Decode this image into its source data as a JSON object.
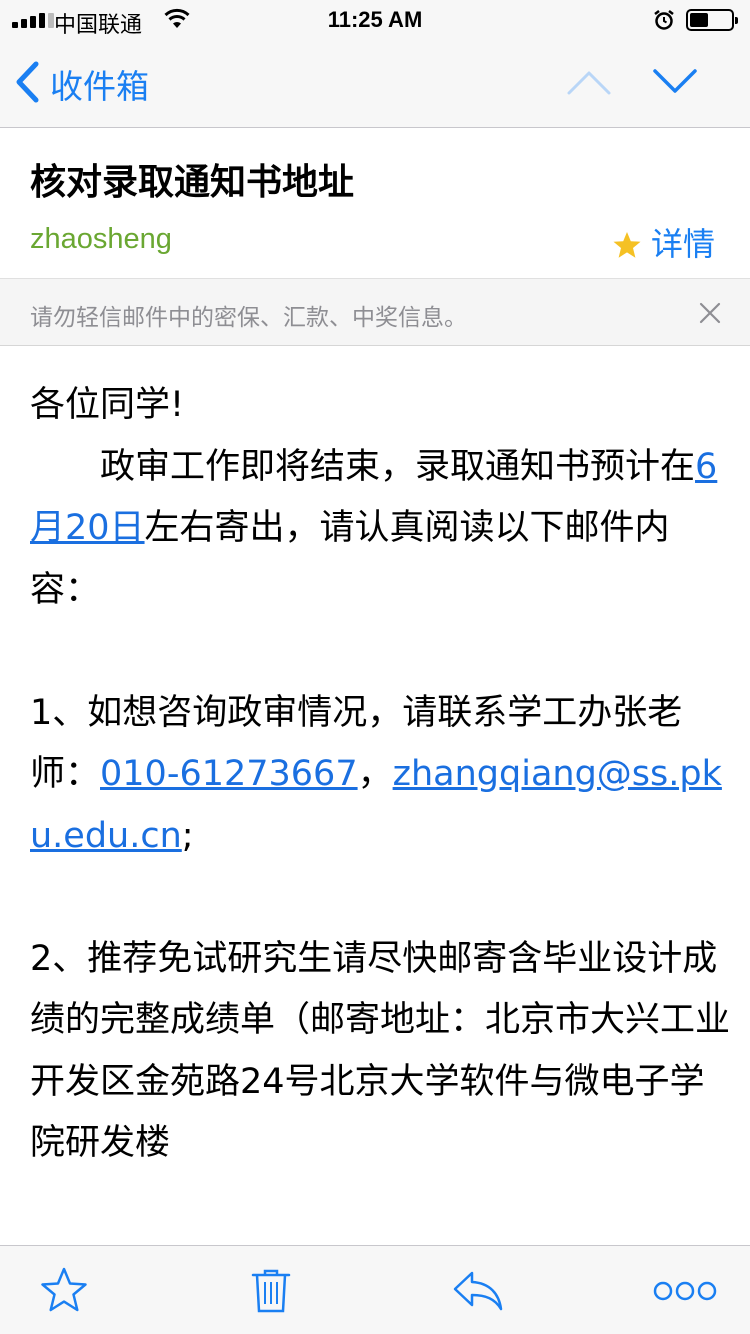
{
  "status_bar": {
    "carrier": "中国联通",
    "time": "11:25 AM",
    "icons": [
      "signal-icon",
      "wifi-icon",
      "alarm-icon",
      "battery-icon"
    ]
  },
  "nav": {
    "back_label": "收件箱",
    "icons": [
      "back-chevron-icon",
      "previous-message-icon",
      "next-message-icon"
    ]
  },
  "header": {
    "subject": "核对录取通知书地址",
    "sender": "zhaosheng",
    "details_label": "详情",
    "star_color": "#f5c124"
  },
  "warning": {
    "text": "请勿轻信邮件中的密保、汇款、中奖信息。"
  },
  "body": {
    "greeting": "各位同学!",
    "para1_a": "政审工作即将结束，录取通知书预计在",
    "para1_link": "6月20日",
    "para1_b": "左右寄出，请认真阅读以下邮件内容：",
    "item1_a": "1、如想咨询政审情况，请联系学工办张老师：",
    "item1_phone": "010-61273667",
    "item1_sep": "，",
    "item1_email": "zhangqiang@ss.pku.edu.cn",
    "item1_end": ";",
    "item2": "2、推荐免试研究生请尽快邮寄含毕业设计成绩的完整成绩单（邮寄地址：北京市大兴工业开发区金苑路24号北京大学软件与微电子学院研发楼"
  },
  "toolbar": {
    "icons": [
      "star-outline-icon",
      "trash-icon",
      "reply-icon",
      "more-icon"
    ]
  },
  "colors": {
    "accent": "#1a7ff2",
    "sender": "#6aa732",
    "link": "#1a6fe0"
  }
}
